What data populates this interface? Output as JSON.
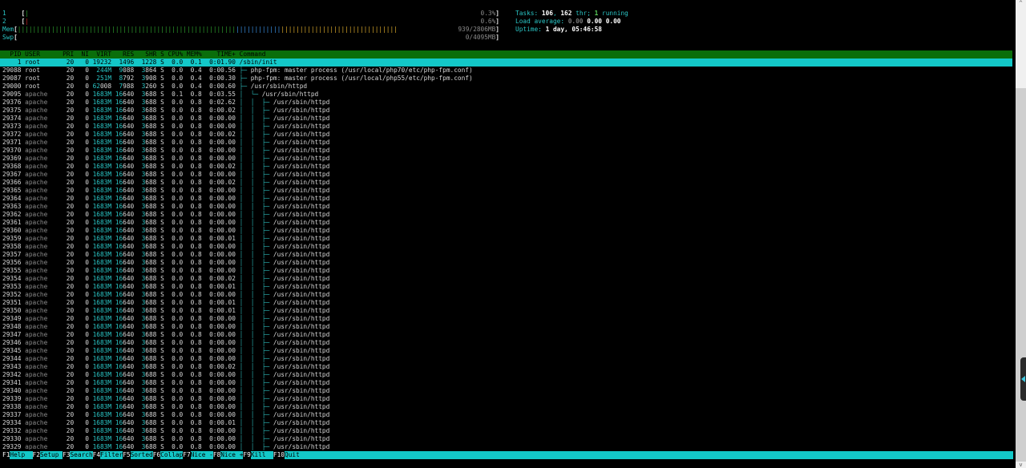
{
  "meters": {
    "cpu": [
      {
        "label": "1",
        "percent_text": "0.3%",
        "fraction": 0.003
      },
      {
        "label": "2",
        "percent_text": "0.6%",
        "fraction": 0.006
      }
    ],
    "mem": {
      "label": "Mem",
      "value_text": "939/2806MB",
      "used_fraction": 0.47,
      "buffers_fraction": 0.1,
      "cache_fraction": 0.25
    },
    "swp": {
      "label": "Swp",
      "value_text": "0/4095MB",
      "fraction": 0
    }
  },
  "info": {
    "tasks_label": "Tasks: ",
    "tasks": "106",
    "sep1": ", ",
    "threads": "162",
    "thr_label": " thr; ",
    "running": "1",
    "running_label": " running",
    "load_label": "Load average: ",
    "load1": "0.00",
    "load5": "0.00",
    "load15": "0.00",
    "uptime_label": "Uptime: ",
    "uptime": "1 day, 05:46:58"
  },
  "columns": {
    "pid": "PID",
    "user": "USER",
    "pri": "PRI",
    "ni": "NI",
    "virt": "VIRT",
    "res": "RES",
    "shr": "SHR",
    "s": "S",
    "cpu": "CPU%",
    "mem": "MEM%",
    "time": "TIME+",
    "cmd": "Command"
  },
  "processes": [
    {
      "pid": "1",
      "user": "root",
      "pri": "20",
      "ni": "0",
      "virt": "19232",
      "res": "1496",
      "shr": "1228",
      "s": "S",
      "cpu": "0.0",
      "mem": "0.1",
      "time": "0:01.90",
      "cmd": "/sbin/init",
      "depth": 0,
      "selected": true
    },
    {
      "pid": "29088",
      "user": "root",
      "pri": "20",
      "ni": "0",
      "virt": "244M",
      "res": "9088",
      "shr": "3864",
      "s": "S",
      "cpu": "0.0",
      "mem": "0.4",
      "time": "0:00.56",
      "cmd": "php-fpm: master process (/usr/local/php70/etc/php-fpm.conf)",
      "depth": 1
    },
    {
      "pid": "29087",
      "user": "root",
      "pri": "20",
      "ni": "0",
      "virt": "251M",
      "res": "8792",
      "shr": "3908",
      "s": "S",
      "cpu": "0.0",
      "mem": "0.4",
      "time": "0:00.30",
      "cmd": "php-fpm: master process (/usr/local/php55/etc/php-fpm.conf)",
      "depth": 1
    },
    {
      "pid": "29000",
      "user": "root",
      "pri": "20",
      "ni": "0",
      "virt": "62008",
      "res": "7988",
      "shr": "3260",
      "s": "S",
      "cpu": "0.0",
      "mem": "0.4",
      "time": "0:00.60",
      "cmd": "/usr/sbin/httpd",
      "depth": 1
    },
    {
      "pid": "29095",
      "user": "apache",
      "pri": "20",
      "ni": "0",
      "virt": "1683M",
      "res": "16640",
      "shr": "3688",
      "s": "S",
      "cpu": "0.1",
      "mem": "0.8",
      "time": "0:03.55",
      "cmd": "/usr/sbin/httpd",
      "depth": 2
    },
    {
      "pid": "29376",
      "user": "apache",
      "pri": "20",
      "ni": "0",
      "virt": "1683M",
      "res": "16640",
      "shr": "3688",
      "s": "S",
      "cpu": "0.0",
      "mem": "0.8",
      "time": "0:02.62",
      "cmd": "/usr/sbin/httpd",
      "depth": 3
    },
    {
      "pid": "29375",
      "user": "apache",
      "pri": "20",
      "ni": "0",
      "virt": "1683M",
      "res": "16640",
      "shr": "3688",
      "s": "S",
      "cpu": "0.0",
      "mem": "0.8",
      "time": "0:00.02",
      "cmd": "/usr/sbin/httpd",
      "depth": 3
    },
    {
      "pid": "29374",
      "user": "apache",
      "pri": "20",
      "ni": "0",
      "virt": "1683M",
      "res": "16640",
      "shr": "3688",
      "s": "S",
      "cpu": "0.0",
      "mem": "0.8",
      "time": "0:00.00",
      "cmd": "/usr/sbin/httpd",
      "depth": 3
    },
    {
      "pid": "29373",
      "user": "apache",
      "pri": "20",
      "ni": "0",
      "virt": "1683M",
      "res": "16640",
      "shr": "3688",
      "s": "S",
      "cpu": "0.0",
      "mem": "0.8",
      "time": "0:00.00",
      "cmd": "/usr/sbin/httpd",
      "depth": 3
    },
    {
      "pid": "29372",
      "user": "apache",
      "pri": "20",
      "ni": "0",
      "virt": "1683M",
      "res": "16640",
      "shr": "3688",
      "s": "S",
      "cpu": "0.0",
      "mem": "0.8",
      "time": "0:00.02",
      "cmd": "/usr/sbin/httpd",
      "depth": 3
    },
    {
      "pid": "29371",
      "user": "apache",
      "pri": "20",
      "ni": "0",
      "virt": "1683M",
      "res": "16640",
      "shr": "3688",
      "s": "S",
      "cpu": "0.0",
      "mem": "0.8",
      "time": "0:00.00",
      "cmd": "/usr/sbin/httpd",
      "depth": 3
    },
    {
      "pid": "29370",
      "user": "apache",
      "pri": "20",
      "ni": "0",
      "virt": "1683M",
      "res": "16640",
      "shr": "3688",
      "s": "S",
      "cpu": "0.0",
      "mem": "0.8",
      "time": "0:00.00",
      "cmd": "/usr/sbin/httpd",
      "depth": 3
    },
    {
      "pid": "29369",
      "user": "apache",
      "pri": "20",
      "ni": "0",
      "virt": "1683M",
      "res": "16640",
      "shr": "3688",
      "s": "S",
      "cpu": "0.0",
      "mem": "0.8",
      "time": "0:00.00",
      "cmd": "/usr/sbin/httpd",
      "depth": 3
    },
    {
      "pid": "29368",
      "user": "apache",
      "pri": "20",
      "ni": "0",
      "virt": "1683M",
      "res": "16640",
      "shr": "3688",
      "s": "S",
      "cpu": "0.0",
      "mem": "0.8",
      "time": "0:00.02",
      "cmd": "/usr/sbin/httpd",
      "depth": 3
    },
    {
      "pid": "29367",
      "user": "apache",
      "pri": "20",
      "ni": "0",
      "virt": "1683M",
      "res": "16640",
      "shr": "3688",
      "s": "S",
      "cpu": "0.0",
      "mem": "0.8",
      "time": "0:00.00",
      "cmd": "/usr/sbin/httpd",
      "depth": 3
    },
    {
      "pid": "29366",
      "user": "apache",
      "pri": "20",
      "ni": "0",
      "virt": "1683M",
      "res": "16640",
      "shr": "3688",
      "s": "S",
      "cpu": "0.0",
      "mem": "0.8",
      "time": "0:00.02",
      "cmd": "/usr/sbin/httpd",
      "depth": 3
    },
    {
      "pid": "29365",
      "user": "apache",
      "pri": "20",
      "ni": "0",
      "virt": "1683M",
      "res": "16640",
      "shr": "3688",
      "s": "S",
      "cpu": "0.0",
      "mem": "0.8",
      "time": "0:00.00",
      "cmd": "/usr/sbin/httpd",
      "depth": 3
    },
    {
      "pid": "29364",
      "user": "apache",
      "pri": "20",
      "ni": "0",
      "virt": "1683M",
      "res": "16640",
      "shr": "3688",
      "s": "S",
      "cpu": "0.0",
      "mem": "0.8",
      "time": "0:00.00",
      "cmd": "/usr/sbin/httpd",
      "depth": 3
    },
    {
      "pid": "29363",
      "user": "apache",
      "pri": "20",
      "ni": "0",
      "virt": "1683M",
      "res": "16640",
      "shr": "3688",
      "s": "S",
      "cpu": "0.0",
      "mem": "0.8",
      "time": "0:00.00",
      "cmd": "/usr/sbin/httpd",
      "depth": 3
    },
    {
      "pid": "29362",
      "user": "apache",
      "pri": "20",
      "ni": "0",
      "virt": "1683M",
      "res": "16640",
      "shr": "3688",
      "s": "S",
      "cpu": "0.0",
      "mem": "0.8",
      "time": "0:00.00",
      "cmd": "/usr/sbin/httpd",
      "depth": 3
    },
    {
      "pid": "29361",
      "user": "apache",
      "pri": "20",
      "ni": "0",
      "virt": "1683M",
      "res": "16640",
      "shr": "3688",
      "s": "S",
      "cpu": "0.0",
      "mem": "0.8",
      "time": "0:00.00",
      "cmd": "/usr/sbin/httpd",
      "depth": 3
    },
    {
      "pid": "29360",
      "user": "apache",
      "pri": "20",
      "ni": "0",
      "virt": "1683M",
      "res": "16640",
      "shr": "3688",
      "s": "S",
      "cpu": "0.0",
      "mem": "0.8",
      "time": "0:00.00",
      "cmd": "/usr/sbin/httpd",
      "depth": 3
    },
    {
      "pid": "29359",
      "user": "apache",
      "pri": "20",
      "ni": "0",
      "virt": "1683M",
      "res": "16640",
      "shr": "3688",
      "s": "S",
      "cpu": "0.0",
      "mem": "0.8",
      "time": "0:00.01",
      "cmd": "/usr/sbin/httpd",
      "depth": 3
    },
    {
      "pid": "29358",
      "user": "apache",
      "pri": "20",
      "ni": "0",
      "virt": "1683M",
      "res": "16640",
      "shr": "3688",
      "s": "S",
      "cpu": "0.0",
      "mem": "0.8",
      "time": "0:00.00",
      "cmd": "/usr/sbin/httpd",
      "depth": 3
    },
    {
      "pid": "29357",
      "user": "apache",
      "pri": "20",
      "ni": "0",
      "virt": "1683M",
      "res": "16640",
      "shr": "3688",
      "s": "S",
      "cpu": "0.0",
      "mem": "0.8",
      "time": "0:00.00",
      "cmd": "/usr/sbin/httpd",
      "depth": 3
    },
    {
      "pid": "29356",
      "user": "apache",
      "pri": "20",
      "ni": "0",
      "virt": "1683M",
      "res": "16640",
      "shr": "3688",
      "s": "S",
      "cpu": "0.0",
      "mem": "0.8",
      "time": "0:00.00",
      "cmd": "/usr/sbin/httpd",
      "depth": 3
    },
    {
      "pid": "29355",
      "user": "apache",
      "pri": "20",
      "ni": "0",
      "virt": "1683M",
      "res": "16640",
      "shr": "3688",
      "s": "S",
      "cpu": "0.0",
      "mem": "0.8",
      "time": "0:00.00",
      "cmd": "/usr/sbin/httpd",
      "depth": 3
    },
    {
      "pid": "29354",
      "user": "apache",
      "pri": "20",
      "ni": "0",
      "virt": "1683M",
      "res": "16640",
      "shr": "3688",
      "s": "S",
      "cpu": "0.0",
      "mem": "0.8",
      "time": "0:00.02",
      "cmd": "/usr/sbin/httpd",
      "depth": 3
    },
    {
      "pid": "29353",
      "user": "apache",
      "pri": "20",
      "ni": "0",
      "virt": "1683M",
      "res": "16640",
      "shr": "3688",
      "s": "S",
      "cpu": "0.0",
      "mem": "0.8",
      "time": "0:00.01",
      "cmd": "/usr/sbin/httpd",
      "depth": 3
    },
    {
      "pid": "29352",
      "user": "apache",
      "pri": "20",
      "ni": "0",
      "virt": "1683M",
      "res": "16640",
      "shr": "3688",
      "s": "S",
      "cpu": "0.0",
      "mem": "0.8",
      "time": "0:00.00",
      "cmd": "/usr/sbin/httpd",
      "depth": 3
    },
    {
      "pid": "29351",
      "user": "apache",
      "pri": "20",
      "ni": "0",
      "virt": "1683M",
      "res": "16640",
      "shr": "3688",
      "s": "S",
      "cpu": "0.0",
      "mem": "0.8",
      "time": "0:00.01",
      "cmd": "/usr/sbin/httpd",
      "depth": 3
    },
    {
      "pid": "29350",
      "user": "apache",
      "pri": "20",
      "ni": "0",
      "virt": "1683M",
      "res": "16640",
      "shr": "3688",
      "s": "S",
      "cpu": "0.0",
      "mem": "0.8",
      "time": "0:00.01",
      "cmd": "/usr/sbin/httpd",
      "depth": 3
    },
    {
      "pid": "29349",
      "user": "apache",
      "pri": "20",
      "ni": "0",
      "virt": "1683M",
      "res": "16640",
      "shr": "3688",
      "s": "S",
      "cpu": "0.0",
      "mem": "0.8",
      "time": "0:00.00",
      "cmd": "/usr/sbin/httpd",
      "depth": 3
    },
    {
      "pid": "29348",
      "user": "apache",
      "pri": "20",
      "ni": "0",
      "virt": "1683M",
      "res": "16640",
      "shr": "3688",
      "s": "S",
      "cpu": "0.0",
      "mem": "0.8",
      "time": "0:00.00",
      "cmd": "/usr/sbin/httpd",
      "depth": 3
    },
    {
      "pid": "29347",
      "user": "apache",
      "pri": "20",
      "ni": "0",
      "virt": "1683M",
      "res": "16640",
      "shr": "3688",
      "s": "S",
      "cpu": "0.0",
      "mem": "0.8",
      "time": "0:00.00",
      "cmd": "/usr/sbin/httpd",
      "depth": 3
    },
    {
      "pid": "29346",
      "user": "apache",
      "pri": "20",
      "ni": "0",
      "virt": "1683M",
      "res": "16640",
      "shr": "3688",
      "s": "S",
      "cpu": "0.0",
      "mem": "0.8",
      "time": "0:00.00",
      "cmd": "/usr/sbin/httpd",
      "depth": 3
    },
    {
      "pid": "29345",
      "user": "apache",
      "pri": "20",
      "ni": "0",
      "virt": "1683M",
      "res": "16640",
      "shr": "3688",
      "s": "S",
      "cpu": "0.0",
      "mem": "0.8",
      "time": "0:00.00",
      "cmd": "/usr/sbin/httpd",
      "depth": 3
    },
    {
      "pid": "29344",
      "user": "apache",
      "pri": "20",
      "ni": "0",
      "virt": "1683M",
      "res": "16640",
      "shr": "3688",
      "s": "S",
      "cpu": "0.0",
      "mem": "0.8",
      "time": "0:00.00",
      "cmd": "/usr/sbin/httpd",
      "depth": 3
    },
    {
      "pid": "29343",
      "user": "apache",
      "pri": "20",
      "ni": "0",
      "virt": "1683M",
      "res": "16640",
      "shr": "3688",
      "s": "S",
      "cpu": "0.0",
      "mem": "0.8",
      "time": "0:00.02",
      "cmd": "/usr/sbin/httpd",
      "depth": 3
    },
    {
      "pid": "29342",
      "user": "apache",
      "pri": "20",
      "ni": "0",
      "virt": "1683M",
      "res": "16640",
      "shr": "3688",
      "s": "S",
      "cpu": "0.0",
      "mem": "0.8",
      "time": "0:00.00",
      "cmd": "/usr/sbin/httpd",
      "depth": 3
    },
    {
      "pid": "29341",
      "user": "apache",
      "pri": "20",
      "ni": "0",
      "virt": "1683M",
      "res": "16640",
      "shr": "3688",
      "s": "S",
      "cpu": "0.0",
      "mem": "0.8",
      "time": "0:00.00",
      "cmd": "/usr/sbin/httpd",
      "depth": 3
    },
    {
      "pid": "29340",
      "user": "apache",
      "pri": "20",
      "ni": "0",
      "virt": "1683M",
      "res": "16640",
      "shr": "3688",
      "s": "S",
      "cpu": "0.0",
      "mem": "0.8",
      "time": "0:00.00",
      "cmd": "/usr/sbin/httpd",
      "depth": 3
    },
    {
      "pid": "29339",
      "user": "apache",
      "pri": "20",
      "ni": "0",
      "virt": "1683M",
      "res": "16640",
      "shr": "3688",
      "s": "S",
      "cpu": "0.0",
      "mem": "0.8",
      "time": "0:00.00",
      "cmd": "/usr/sbin/httpd",
      "depth": 3
    },
    {
      "pid": "29338",
      "user": "apache",
      "pri": "20",
      "ni": "0",
      "virt": "1683M",
      "res": "16640",
      "shr": "3688",
      "s": "S",
      "cpu": "0.0",
      "mem": "0.8",
      "time": "0:00.00",
      "cmd": "/usr/sbin/httpd",
      "depth": 3
    },
    {
      "pid": "29337",
      "user": "apache",
      "pri": "20",
      "ni": "0",
      "virt": "1683M",
      "res": "16640",
      "shr": "3688",
      "s": "S",
      "cpu": "0.0",
      "mem": "0.8",
      "time": "0:00.00",
      "cmd": "/usr/sbin/httpd",
      "depth": 3
    },
    {
      "pid": "29334",
      "user": "apache",
      "pri": "20",
      "ni": "0",
      "virt": "1683M",
      "res": "16640",
      "shr": "3688",
      "s": "S",
      "cpu": "0.0",
      "mem": "0.8",
      "time": "0:00.01",
      "cmd": "/usr/sbin/httpd",
      "depth": 3
    },
    {
      "pid": "29332",
      "user": "apache",
      "pri": "20",
      "ni": "0",
      "virt": "1683M",
      "res": "16640",
      "shr": "3688",
      "s": "S",
      "cpu": "0.0",
      "mem": "0.8",
      "time": "0:00.00",
      "cmd": "/usr/sbin/httpd",
      "depth": 3
    },
    {
      "pid": "29330",
      "user": "apache",
      "pri": "20",
      "ni": "0",
      "virt": "1683M",
      "res": "16640",
      "shr": "3688",
      "s": "S",
      "cpu": "0.0",
      "mem": "0.8",
      "time": "0:00.00",
      "cmd": "/usr/sbin/httpd",
      "depth": 3
    },
    {
      "pid": "29329",
      "user": "apache",
      "pri": "20",
      "ni": "0",
      "virt": "1683M",
      "res": "16640",
      "shr": "3688",
      "s": "S",
      "cpu": "0.0",
      "mem": "0.8",
      "time": "0:00.00",
      "cmd": "/usr/sbin/httpd",
      "depth": 3
    }
  ],
  "footer": [
    {
      "key": "F1",
      "label": "Help"
    },
    {
      "key": "F2",
      "label": "Setup"
    },
    {
      "key": "F3",
      "label": "Search"
    },
    {
      "key": "F4",
      "label": "Filter"
    },
    {
      "key": "F5",
      "label": "Sorted"
    },
    {
      "key": "F6",
      "label": "Collap"
    },
    {
      "key": "F7",
      "label": "Nice -"
    },
    {
      "key": "F8",
      "label": "Nice +"
    },
    {
      "key": "F9",
      "label": "Kill"
    },
    {
      "key": "F10",
      "label": "Quit"
    }
  ],
  "colors": {
    "header_bg": "#0a6e0a",
    "selection": "#13c8c8",
    "accent": "#2ac6c6"
  }
}
